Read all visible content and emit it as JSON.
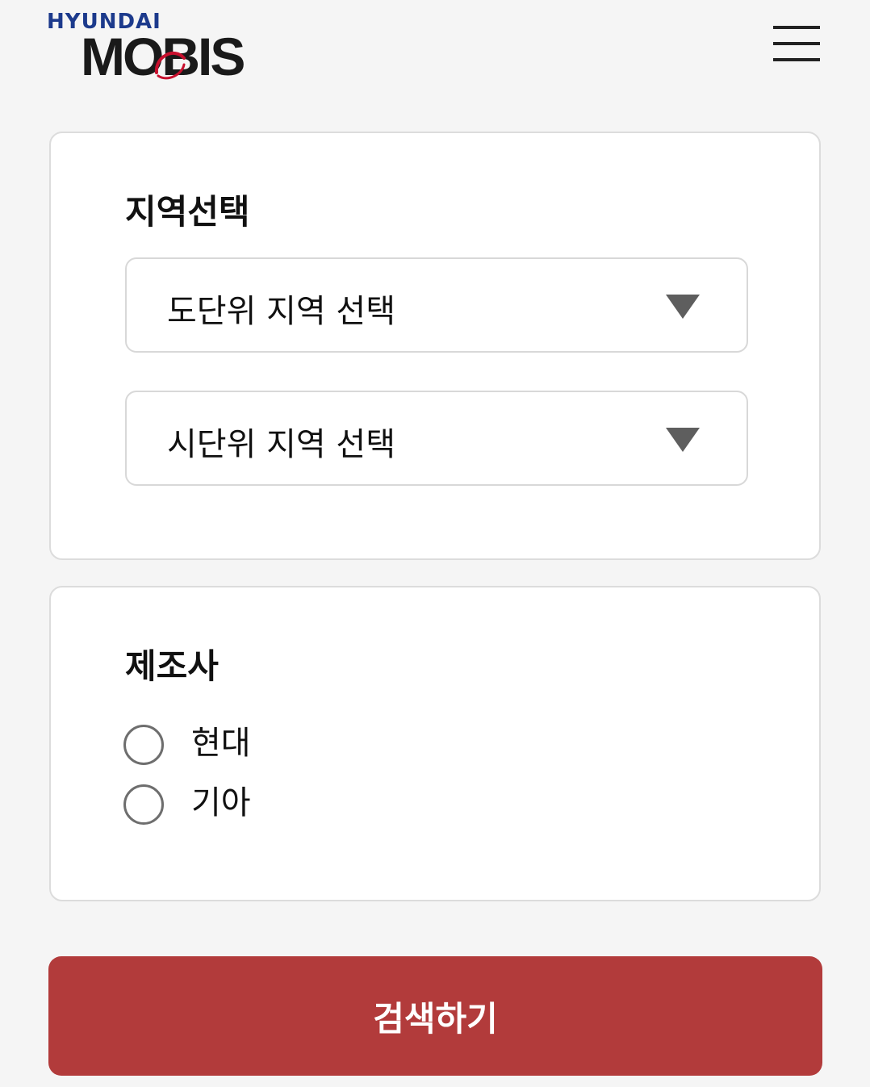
{
  "header": {
    "logo_top": "HYUNDAI",
    "logo_main": "MOBIS",
    "menu_icon": "hamburger-menu-icon",
    "brand_color": "#1c3a8c",
    "accent_color": "#c8102e"
  },
  "region": {
    "title": "지역선택",
    "province_select": {
      "value": "도단위 지역 선택",
      "icon": "dropdown-triangle-icon"
    },
    "city_select": {
      "value": "시단위 지역 선택",
      "icon": "dropdown-triangle-icon"
    }
  },
  "manufacturer": {
    "title": "제조사",
    "options": [
      {
        "label": "현대",
        "selected": false
      },
      {
        "label": "기아",
        "selected": false
      }
    ]
  },
  "search_button": {
    "label": "검색하기",
    "color": "#b23b3b"
  }
}
